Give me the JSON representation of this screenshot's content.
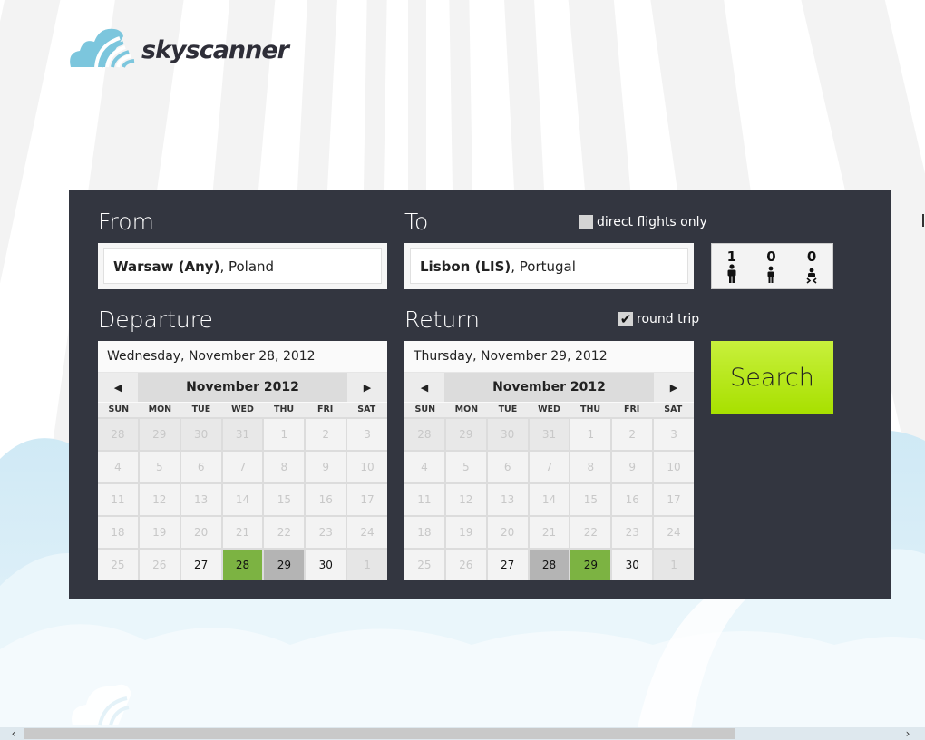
{
  "app": {
    "brand": "skyscanner"
  },
  "colors": {
    "panel": "#333640",
    "accent_green": "#a8e000",
    "selected_date": "#7cb342",
    "paired_date": "#b4b4b4",
    "logo_blue": "#7cc6dd"
  },
  "from": {
    "label": "From",
    "city": "Warsaw (Any)",
    "country": ", Poland"
  },
  "to": {
    "label": "To",
    "city": "Lisbon (LIS)",
    "country": ", Portugal"
  },
  "direct_flights": {
    "label": "direct flights only",
    "checked": false
  },
  "round_trip": {
    "label": "round trip",
    "checked": true,
    "mark": "✔"
  },
  "passengers": {
    "adults": "1",
    "children": "0",
    "infants": "0"
  },
  "departure": {
    "label": "Departure",
    "date_text": "Wednesday, November 28, 2012",
    "month": "November 2012",
    "selected": 28,
    "paired": 29
  },
  "return": {
    "label": "Return",
    "date_text": "Thursday, November 29, 2012",
    "month": "November 2012",
    "selected": 29,
    "paired": 28
  },
  "weekdays": [
    "SUN",
    "MON",
    "TUE",
    "WED",
    "THU",
    "FRI",
    "SAT"
  ],
  "calendar_days": [
    [
      28,
      "prev"
    ],
    [
      29,
      "prev"
    ],
    [
      30,
      "prev"
    ],
    [
      31,
      "prev"
    ],
    [
      1,
      "cur"
    ],
    [
      2,
      "cur"
    ],
    [
      3,
      "cur"
    ],
    [
      4,
      "cur"
    ],
    [
      5,
      "cur"
    ],
    [
      6,
      "cur"
    ],
    [
      7,
      "cur"
    ],
    [
      8,
      "cur"
    ],
    [
      9,
      "cur"
    ],
    [
      10,
      "cur"
    ],
    [
      11,
      "cur"
    ],
    [
      12,
      "cur"
    ],
    [
      13,
      "cur"
    ],
    [
      14,
      "cur"
    ],
    [
      15,
      "cur"
    ],
    [
      16,
      "cur"
    ],
    [
      17,
      "cur"
    ],
    [
      18,
      "cur"
    ],
    [
      19,
      "cur"
    ],
    [
      20,
      "cur"
    ],
    [
      21,
      "cur"
    ],
    [
      22,
      "cur"
    ],
    [
      23,
      "cur"
    ],
    [
      24,
      "cur"
    ],
    [
      25,
      "cur"
    ],
    [
      26,
      "cur"
    ],
    [
      27,
      "active"
    ],
    [
      28,
      "active"
    ],
    [
      29,
      "active"
    ],
    [
      30,
      "active"
    ],
    [
      1,
      "next"
    ]
  ],
  "search": {
    "label": "Search"
  },
  "scroll": {
    "left": "‹",
    "right": "›"
  },
  "icons": {
    "prev_month": "◀",
    "next_month": "▶"
  }
}
